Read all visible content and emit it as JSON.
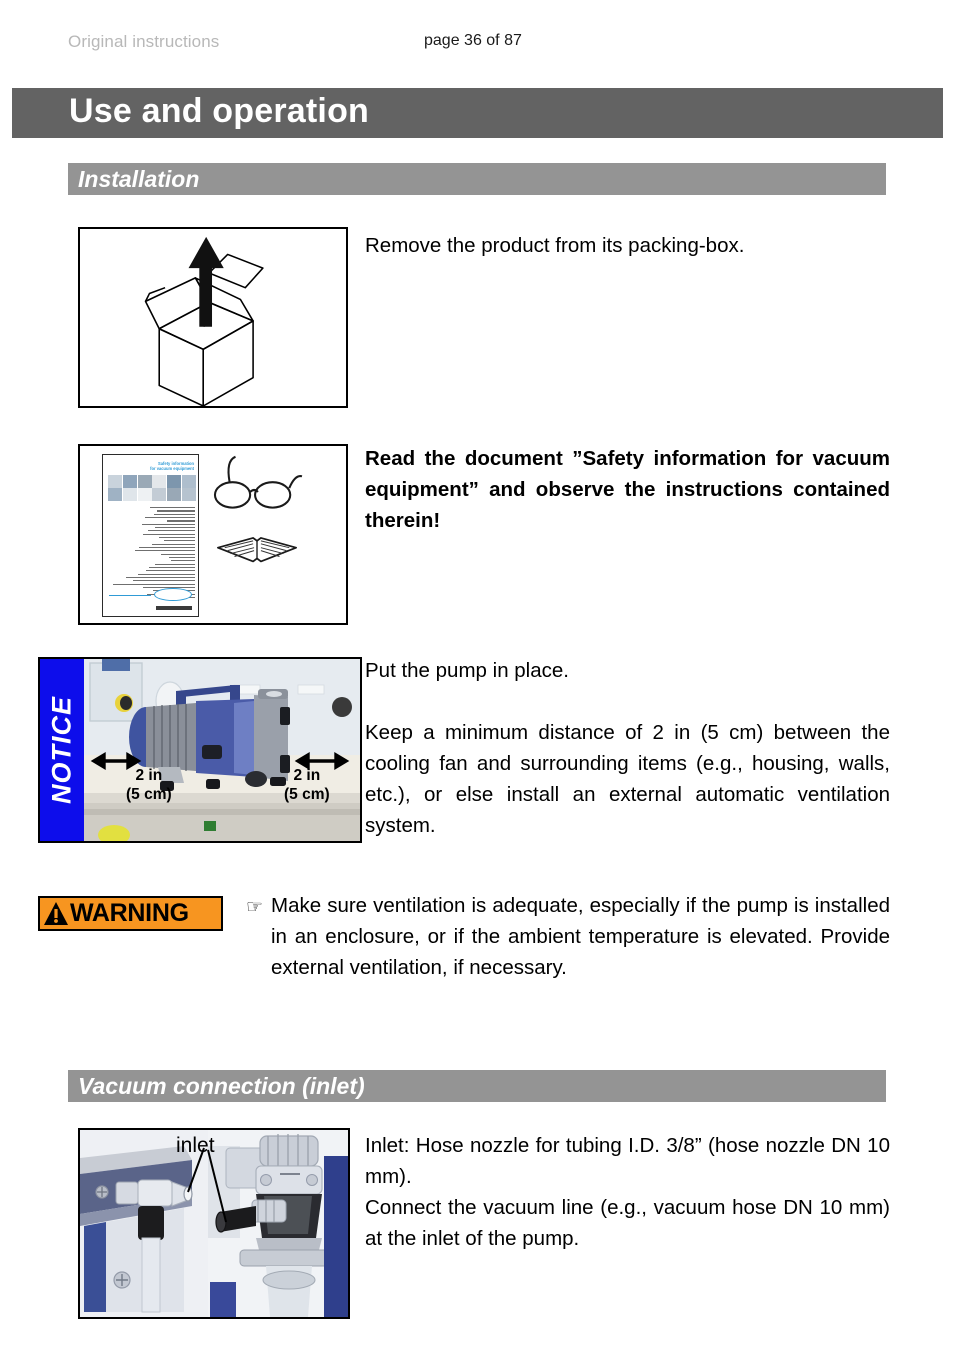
{
  "header": {
    "left_note": "Original instructions",
    "page_indicator": "page 36 of 87"
  },
  "chapter": {
    "title": "Use and operation",
    "bar_color": "#636363"
  },
  "sections": {
    "installation": {
      "title": "Installation",
      "bar_color": "#949494"
    },
    "vacuum_connection": {
      "title": "Vacuum connection (inlet)",
      "bar_color": "#949494"
    }
  },
  "steps": {
    "unpack": {
      "figure_name": "packing-box-with-up-arrow",
      "text": "Remove the product from its packing-box."
    },
    "read_safety": {
      "figure_name": "safety-information-booklet-glasses-and-book",
      "booklet_title_line1": "Safety information",
      "booklet_title_line2": "for vacuum equipment",
      "text": "Read the document ”Safety information for vacuum equipment” and observe the instructions contained therein!"
    },
    "place_pump": {
      "notice_label": "NOTICE",
      "notice_color": "#0d0deb",
      "figure_name": "pump-on-bench-with-clearance-arrows",
      "dimension_left_line1": "2 in",
      "dimension_left_line2": "(5 cm)",
      "dimension_right_line1": "2 in",
      "dimension_right_line2": "(5 cm)",
      "text_line1": "Put the pump in place.",
      "text_line2": "Keep a minimum distance of 2 in (5 cm) between the cooling fan and surrounding items (e.g., housing, walls, etc.), or else install an external automatic ventilation system."
    },
    "ventilation_warning": {
      "badge_label": "WARNING",
      "badge_color": "#f79520",
      "bullet_icon": "☞",
      "text": "Make sure ventilation is adequate, especially if the pump is installed in an enclosure, or if the ambient temperature is elevated. Provide external ventilation, if necessary."
    },
    "inlet": {
      "figure_name": "pump-inlet-hose-nozzle-photo",
      "photo_caption": "inlet",
      "text_line1": "Inlet: Hose nozzle for tubing I.D. 3/8” (hose nozzle DN 10 mm).",
      "text_line2": "Connect the vacuum line (e.g., vacuum hose DN 10 mm) at the inlet of the pump."
    }
  }
}
